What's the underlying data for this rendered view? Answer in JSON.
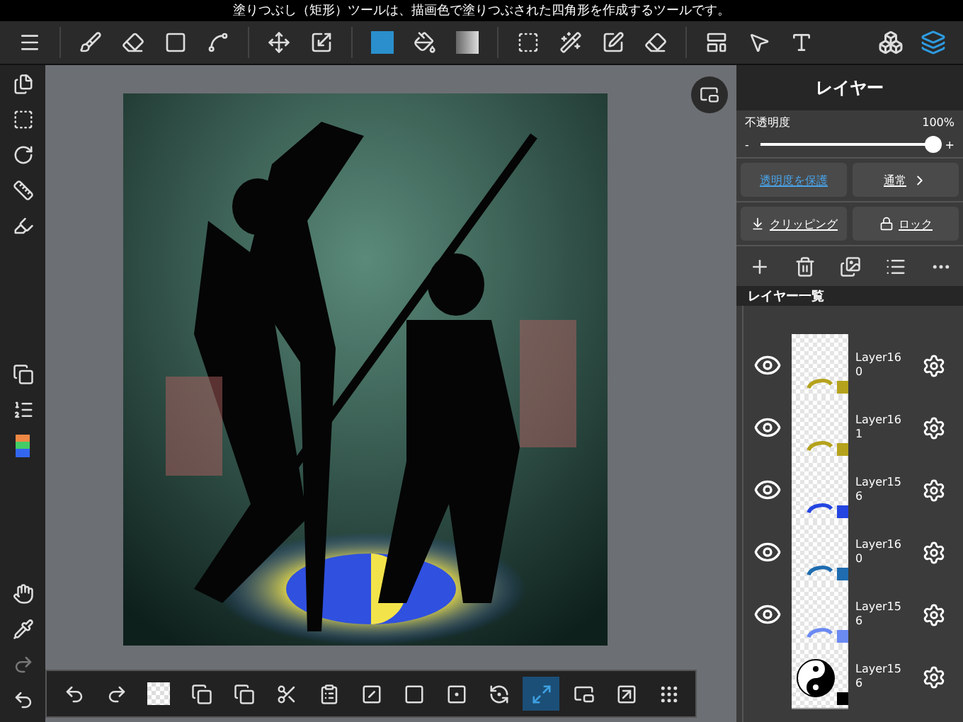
{
  "status_message": "塗りつぶし（矩形）ツールは、描画色で塗りつぶされた四角形を作成するツールです。",
  "panel_buttons": [
    {
      "kind": "materials",
      "selected": false
    },
    {
      "kind": "layers",
      "selected": true
    }
  ],
  "layer_panel": {
    "title": "レイヤー",
    "opacity_label": "不透明度",
    "opacity_value": "100%",
    "level": 1.0,
    "minus": "-",
    "plus": "+",
    "protect_alpha": "透明度を保護",
    "blend_mode": "通常",
    "clipping": "クリッピング",
    "lock": "ロック",
    "list_title": "レイヤー一覧",
    "layers": [
      {
        "name": "Layer160",
        "visible": true,
        "color": "#b5a21c",
        "kind": "swirl"
      },
      {
        "name": "Layer161",
        "visible": true,
        "color": "#b5a21c",
        "kind": "swirl"
      },
      {
        "name": "Layer156",
        "visible": true,
        "color": "#2445e0",
        "kind": "swirl"
      },
      {
        "name": "Layer160",
        "visible": true,
        "color": "#1f6cb0",
        "kind": "swirl"
      },
      {
        "name": "Layer156",
        "visible": true,
        "color": "#6b8af2",
        "kind": "swirl"
      },
      {
        "name": "Layer156",
        "visible": false,
        "color": "#000000",
        "kind": "yin-yang"
      }
    ]
  },
  "bottom_tools": [
    {
      "kind": "undo",
      "selected": false
    },
    {
      "kind": "redo",
      "selected": false
    },
    {
      "kind": "transparent",
      "selected": false
    },
    {
      "kind": "swap",
      "selected": false
    },
    {
      "kind": "copy",
      "selected": false
    },
    {
      "kind": "cut",
      "selected": false
    },
    {
      "kind": "paste",
      "selected": false
    },
    {
      "kind": "deselect",
      "selected": false
    },
    {
      "kind": "frame",
      "selected": false
    },
    {
      "kind": "select-point",
      "selected": false
    },
    {
      "kind": "rotate-reset",
      "selected": false
    },
    {
      "kind": "fit",
      "selected": true
    },
    {
      "kind": "window",
      "selected": false
    },
    {
      "kind": "export",
      "selected": false
    },
    {
      "kind": "grip",
      "selected": false
    }
  ]
}
